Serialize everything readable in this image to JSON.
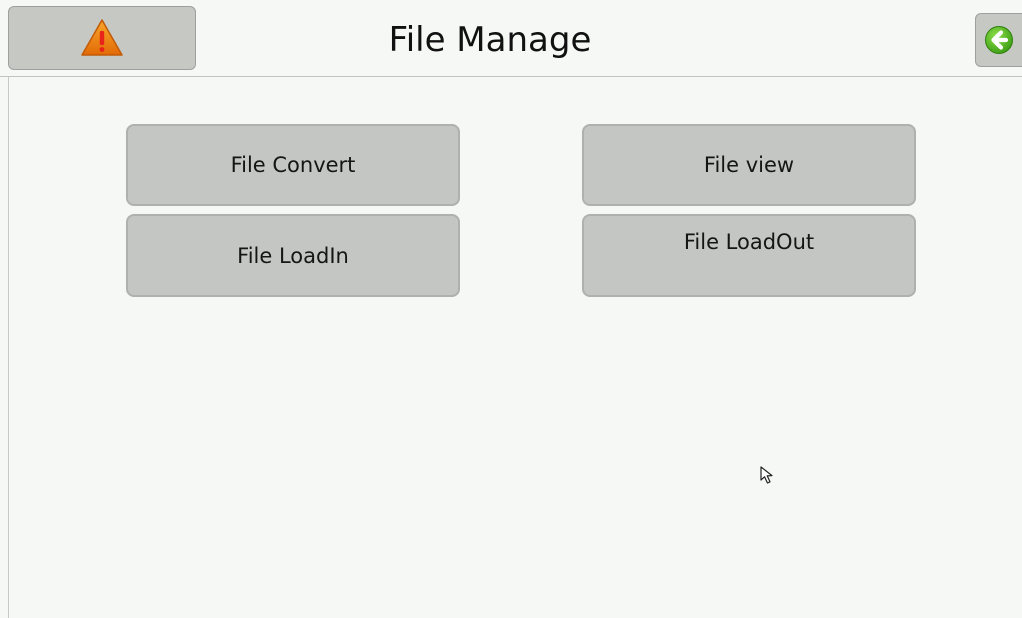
{
  "header": {
    "title": "File Manage",
    "alarm_icon": "warning-triangle-icon",
    "back_icon": "back-arrow-icon"
  },
  "menu": {
    "file_convert": "File Convert",
    "file_view": "File view",
    "file_loadin": "File LoadIn",
    "file_loadout": "File LoadOut"
  },
  "colors": {
    "button_gray": "#c3c6c2",
    "warning_orange": "#f07d0e",
    "back_green": "#4fb81e"
  }
}
